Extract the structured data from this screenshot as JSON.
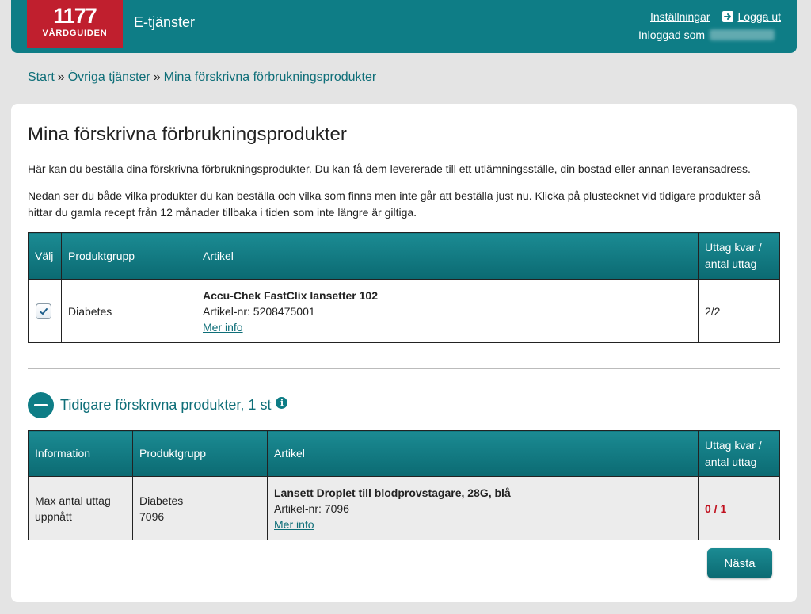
{
  "header": {
    "logo_number": "1177",
    "logo_text": "VÅRDGUIDEN",
    "app_title": "E-tjänster",
    "settings_label": "Inställningar",
    "logout_label": "Logga ut",
    "logged_in_label": "Inloggad som"
  },
  "breadcrumb": {
    "items": [
      "Start",
      "Övriga tjänster",
      "Mina förskrivna förbrukningsprodukter"
    ],
    "separator": "»"
  },
  "page": {
    "title": "Mina förskrivna förbrukningsprodukter",
    "intro1": "Här kan du beställa dina förskrivna förbrukningsprodukter. Du kan få dem levererade till ett utlämningsställe, din bostad eller annan leveransadress.",
    "intro2": "Nedan ser du både vilka produkter du kan beställa och vilka som finns men inte går att beställa just nu. Klicka på plustecknet vid tidigare produkter så hittar du gamla recept från 12 månader tillbaka i tiden som inte längre är giltiga."
  },
  "current_table": {
    "headers": [
      "Välj",
      "Produktgrupp",
      "Artikel",
      "Uttag kvar /",
      "antal uttag"
    ],
    "rows": [
      {
        "selected": true,
        "group": "Diabetes",
        "article_name": "Accu-Chek FastClix lansetter 102",
        "article_nr": "Artikel-nr: 5208475001",
        "more_info": "Mer info ",
        "withdrawals": "2/2"
      }
    ]
  },
  "previous": {
    "title": "Tidigare förskrivna produkter, 1 st",
    "info_glyph": "i",
    "headers": [
      "Information",
      "Produktgrupp",
      "Artikel",
      "Uttag kvar /",
      "antal uttag"
    ],
    "rows": [
      {
        "info_line1": "Max antal uttag",
        "info_line2": "uppnått",
        "group": "Diabetes",
        "group_code": "7096",
        "article_name": "Lansett Droplet till blodprovstagare, 28G, blå",
        "article_nr": "Artikel-nr: 7096",
        "more_info": "Mer info ",
        "withdrawals": "0 / 1"
      }
    ]
  },
  "actions": {
    "next_label": "Nästa"
  },
  "colors": {
    "brand_teal": "#0e7d86",
    "brand_red": "#c01f2e",
    "warning_red": "#c0101e"
  }
}
